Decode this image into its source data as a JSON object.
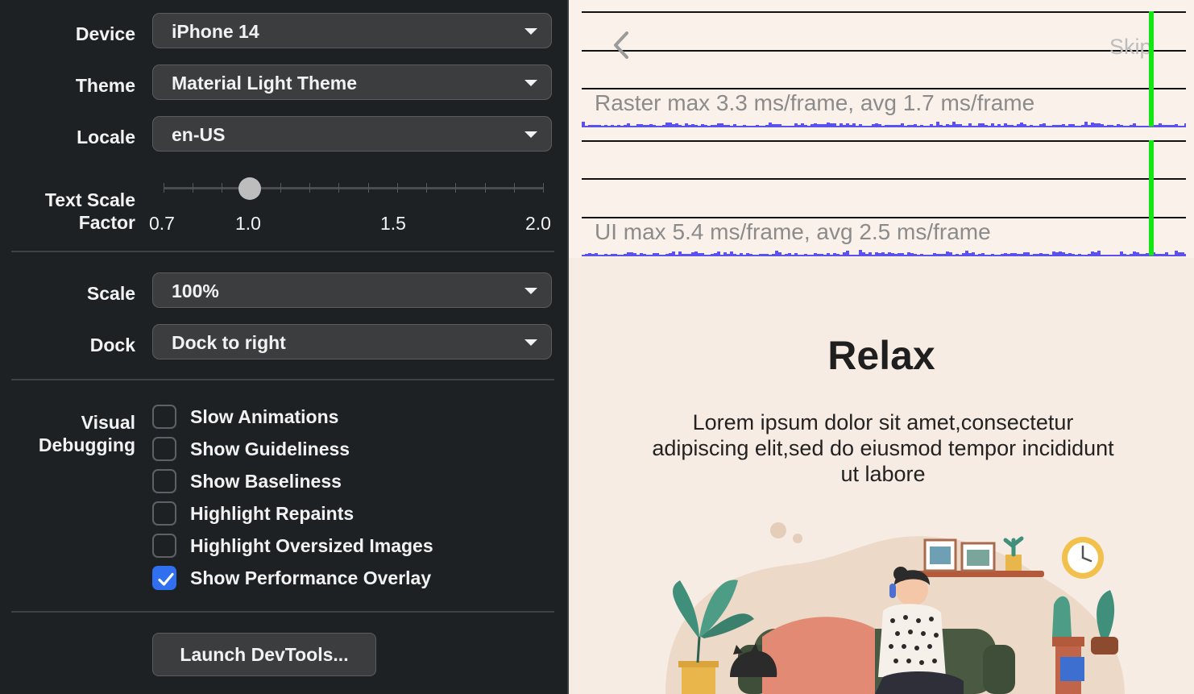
{
  "settings": {
    "device": {
      "label": "Device",
      "value": "iPhone 14"
    },
    "theme": {
      "label": "Theme",
      "value": "Material Light Theme"
    },
    "locale": {
      "label": "Locale",
      "value": "en-US"
    },
    "text_scale": {
      "label_line1": "Text Scale",
      "label_line2": "Factor",
      "value": 1.0,
      "min": 0.7,
      "max": 2.0,
      "tick_labels": [
        "0.7",
        "1.0",
        "1.5",
        "2.0"
      ]
    },
    "scale": {
      "label": "Scale",
      "value": "100%"
    },
    "dock": {
      "label": "Dock",
      "value": "Dock to right"
    },
    "visual_debugging": {
      "label_line1": "Visual",
      "label_line2": "Debugging",
      "options": [
        {
          "label": "Slow Animations",
          "checked": false
        },
        {
          "label": "Show Guideliness",
          "checked": false
        },
        {
          "label": "Show Baseliness",
          "checked": false
        },
        {
          "label": "Highlight Repaints",
          "checked": false
        },
        {
          "label": "Highlight Oversized Images",
          "checked": false
        },
        {
          "label": "Show Performance Overlay",
          "checked": true
        }
      ]
    },
    "launch_button": "Launch DevTools..."
  },
  "preview": {
    "back_icon": "chevron-left-icon",
    "skip": "Skip",
    "raster_overlay": "Raster  max 3.3 ms/frame, avg 1.7 ms/frame",
    "ui_overlay": "UI  max 5.4 ms/frame, avg 2.5 ms/frame",
    "title": "Relax",
    "body": "Lorem ipsum dolor sit amet,consectetur adipiscing elit,sed do eiusmod tempor incididunt ut labore",
    "illustration": "person-relaxing-on-sofa-illustration"
  },
  "colors": {
    "panel_bg": "#1e2124",
    "control_bg": "#3c3d3f",
    "accent_blue": "#2f6ff0",
    "overlay_bars": "#5b50f0",
    "frame_marker": "#14e614",
    "preview_bg": "#f7ece3"
  }
}
